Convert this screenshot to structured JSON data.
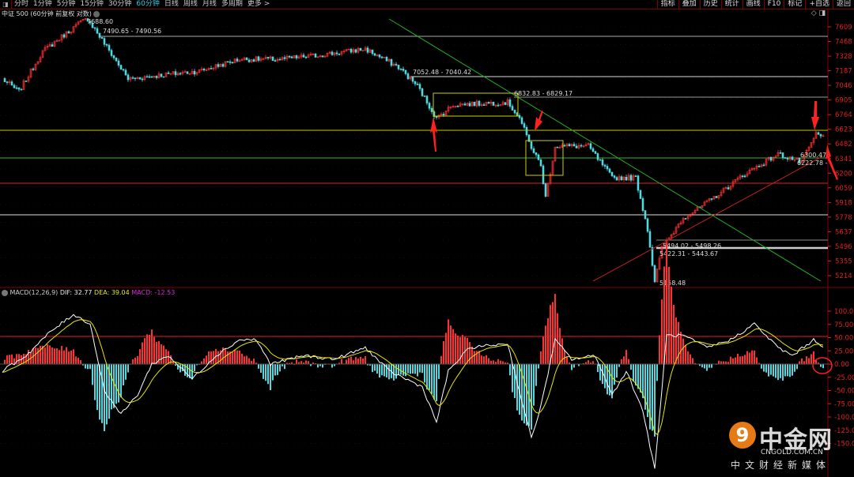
{
  "toolbar": {
    "periods": [
      "分时",
      "1分钟",
      "5分钟",
      "15分钟",
      "30分钟",
      "60分钟",
      "日线",
      "周线",
      "月线",
      "多周期",
      "更多 >"
    ],
    "active_period": "60分钟",
    "tools": [
      "指标",
      "叠加",
      "历史",
      "统计",
      "画线",
      "F10",
      "标记",
      "+自选",
      "返回"
    ]
  },
  "title": "中证 500 (60分钟 前复权 对数)",
  "colors": {
    "up": "#ff3232",
    "down": "#54d8e0",
    "dif": "#ffffff",
    "dea": "#e8e800",
    "macd": "#e020e0",
    "axis": "#e02020"
  },
  "price_axis": [
    "7609",
    "7468",
    "7328",
    "7187",
    "7046",
    "6905",
    "6764",
    "6623",
    "6482",
    "6341",
    "6200",
    "6059",
    "5918",
    "5778",
    "5637",
    "5496",
    "5355",
    "5214"
  ],
  "price_annotations": [
    "7688.60",
    "7490.65 - 7490.56",
    "7052.48 - 7040.42",
    "6832.83 - 6829.17",
    "6300.47",
    "6222.78 -",
    "5494.02 - 5498.26",
    "5422.31 - 5443.67",
    "5158.48"
  ],
  "macd": {
    "label": "MACD(12,26,9)",
    "dif": "DIF: 32.77",
    "dea": "DEA: 39.04",
    "macd": "MACD: -12.53",
    "axis": [
      "100.0",
      "75.00",
      "50.00",
      "25.00",
      "0.00",
      "-25.00",
      "-50.00",
      "-75.00",
      "-100.0",
      "-125.0",
      "-150.0"
    ]
  },
  "chart_data": {
    "type": "candlestick",
    "price_path": [
      [
        0,
        7107
      ],
      [
        7,
        6987
      ],
      [
        17,
        7373
      ],
      [
        33,
        7654
      ],
      [
        36,
        7688
      ],
      [
        43,
        7449
      ],
      [
        53,
        7107
      ],
      [
        67,
        7145
      ],
      [
        83,
        7183
      ],
      [
        100,
        7297
      ],
      [
        117,
        7297
      ],
      [
        133,
        7335
      ],
      [
        153,
        7396
      ],
      [
        167,
        7221
      ],
      [
        175,
        7040
      ],
      [
        183,
        6727
      ],
      [
        190,
        6859
      ],
      [
        213,
        6883
      ],
      [
        218,
        6736
      ],
      [
        222,
        6499
      ],
      [
        227,
        6271
      ],
      [
        229,
        5966
      ],
      [
        233,
        6461
      ],
      [
        247,
        6461
      ],
      [
        257,
        6157
      ],
      [
        267,
        6157
      ],
      [
        272,
        5662
      ],
      [
        275,
        5158
      ],
      [
        278,
        5472
      ],
      [
        287,
        5776
      ],
      [
        293,
        5852
      ],
      [
        300,
        5966
      ],
      [
        313,
        6195
      ],
      [
        327,
        6385
      ],
      [
        337,
        6309
      ],
      [
        343,
        6575
      ],
      [
        347,
        6537
      ]
    ],
    "dif_path": [
      [
        0,
        -13
      ],
      [
        10,
        16
      ],
      [
        20,
        60
      ],
      [
        30,
        94
      ],
      [
        37,
        76
      ],
      [
        43,
        -50
      ],
      [
        50,
        -95
      ],
      [
        57,
        -58
      ],
      [
        63,
        0
      ],
      [
        70,
        16
      ],
      [
        80,
        -28
      ],
      [
        90,
        16
      ],
      [
        100,
        46
      ],
      [
        107,
        46
      ],
      [
        113,
        0
      ],
      [
        127,
        16
      ],
      [
        140,
        9
      ],
      [
        153,
        31
      ],
      [
        163,
        -13
      ],
      [
        177,
        -43
      ],
      [
        183,
        -110
      ],
      [
        188,
        -13
      ],
      [
        197,
        31
      ],
      [
        213,
        39
      ],
      [
        220,
        -88
      ],
      [
        223,
        -140
      ],
      [
        227,
        -80
      ],
      [
        233,
        46
      ],
      [
        240,
        9
      ],
      [
        250,
        16
      ],
      [
        257,
        -58
      ],
      [
        263,
        -13
      ],
      [
        270,
        -88
      ],
      [
        275,
        -200
      ],
      [
        280,
        54
      ],
      [
        287,
        54
      ],
      [
        297,
        31
      ],
      [
        307,
        46
      ],
      [
        317,
        76
      ],
      [
        327,
        31
      ],
      [
        333,
        16
      ],
      [
        342,
        46
      ],
      [
        347,
        31
      ]
    ],
    "ylim_price": [
      5214,
      7609
    ],
    "ylim_macd": [
      -150,
      100
    ]
  },
  "watermark": {
    "brand": "中金网",
    "site": "CNGOLD.COM.CN",
    "slogan": "中文财经新媒体"
  }
}
